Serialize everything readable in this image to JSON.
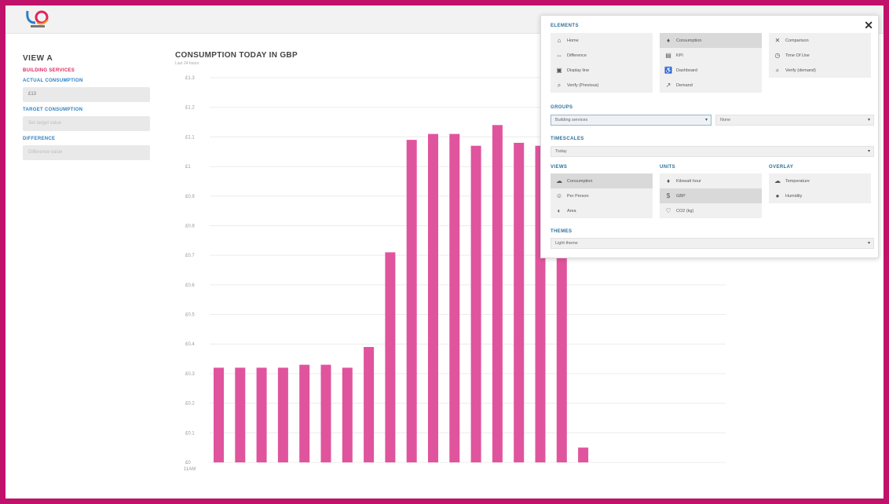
{
  "header": {
    "logo_text": "LSI"
  },
  "sidebar": {
    "view_title": "VIEW A",
    "section_building": "BUILDING SERVICES",
    "actual_label": "ACTUAL CONSUMPTION",
    "actual_value": "£13",
    "target_label": "TARGET CONSUMPTION",
    "target_value": "Set target value",
    "difference_label": "DIFFERENCE",
    "difference_value": "Difference value"
  },
  "chart": {
    "title": "CONSUMPTION TODAY IN GBP",
    "subtitle": "Last 24 hours"
  },
  "chart_data": {
    "type": "bar",
    "title": "CONSUMPTION TODAY IN GBP",
    "y_ticks": [
      "£1.3",
      "£1.2",
      "£1.1",
      "£1",
      "£0.9",
      "£0.8",
      "£0.7",
      "£0.6",
      "£0.5",
      "£0.4",
      "£0.3",
      "£0.2",
      "£0.1",
      "£0"
    ],
    "x_first_label": "11AM",
    "ylim": [
      0,
      1.3
    ],
    "values": [
      0.32,
      0.32,
      0.32,
      0.32,
      0.33,
      0.33,
      0.32,
      0.39,
      0.71,
      1.09,
      1.11,
      1.11,
      1.07,
      1.14,
      1.08,
      1.07,
      0.69,
      0.05
    ],
    "color": "#e0549e"
  },
  "panel": {
    "close_label": "✕",
    "elements_heading": "ELEMENTS",
    "elements": [
      [
        {
          "icon": "home-icon",
          "glyph": "⌂",
          "label": "Home",
          "selected": false
        },
        {
          "icon": "difference-icon",
          "glyph": "⇔",
          "label": "Difference",
          "selected": false
        },
        {
          "icon": "display-icon",
          "glyph": "▣",
          "label": "Display line",
          "selected": false
        },
        {
          "icon": "verify-icon",
          "glyph": "⌕",
          "label": "Verify (Previous)",
          "selected": false
        }
      ],
      [
        {
          "icon": "consumption-icon",
          "glyph": "♦",
          "label": "Consumption",
          "selected": true
        },
        {
          "icon": "kpi-icon",
          "glyph": "▤",
          "label": "KPI",
          "selected": false
        },
        {
          "icon": "dashboard-icon",
          "glyph": "♿",
          "label": "Dashboard",
          "selected": false
        },
        {
          "icon": "demand-icon",
          "glyph": "↗",
          "label": "Demand",
          "selected": false
        }
      ],
      [
        {
          "icon": "comparison-icon",
          "glyph": "✕",
          "label": "Comparison",
          "selected": false
        },
        {
          "icon": "time-of-use-icon",
          "glyph": "◷",
          "label": "Time Of Use",
          "selected": false
        },
        {
          "icon": "verify-demand-icon",
          "glyph": "⌕",
          "label": "Verify (demand)",
          "selected": false
        }
      ]
    ],
    "groups_heading": "GROUPS",
    "group_primary": "Building services",
    "group_secondary": "None",
    "timescales_heading": "TIMESCALES",
    "timescale_value": "Today",
    "views_heading": "VIEWS",
    "views": [
      {
        "icon": "consumption-view-icon",
        "glyph": "☁",
        "label": "Consumption",
        "selected": true
      },
      {
        "icon": "per-person-icon",
        "glyph": "☺",
        "label": "Per Person",
        "selected": false
      },
      {
        "icon": "area-icon",
        "glyph": "◐",
        "label": "Area",
        "selected": false
      }
    ],
    "units_heading": "UNITS",
    "units": [
      {
        "icon": "kwh-icon",
        "glyph": "♦",
        "label": "Kilowatt hour",
        "selected": false
      },
      {
        "icon": "gbp-icon",
        "glyph": "$",
        "label": "GBP",
        "selected": true
      },
      {
        "icon": "co2-icon",
        "glyph": "♡",
        "label": "CO2 (kg)",
        "selected": false
      }
    ],
    "overlay_heading": "OVERLAY",
    "overlay": [
      {
        "icon": "temperature-icon",
        "glyph": "☁",
        "label": "Temperature",
        "selected": false
      },
      {
        "icon": "humidity-icon",
        "glyph": "●",
        "label": "Humidity",
        "selected": false
      }
    ],
    "themes_heading": "THEMES",
    "theme_value": "Light theme"
  }
}
